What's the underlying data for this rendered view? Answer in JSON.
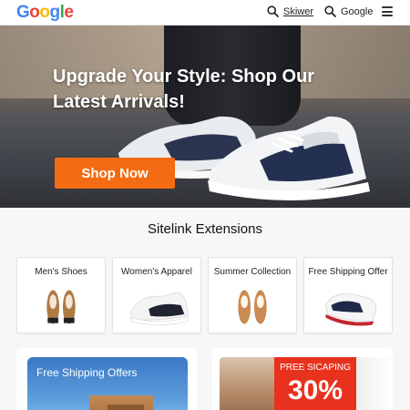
{
  "header": {
    "logo_letters": [
      "G",
      "o",
      "o",
      "g",
      "l",
      "e"
    ],
    "link1": "Skiwer",
    "link2": "Google"
  },
  "hero": {
    "title": "Upgrade Your Style: Shop Our Latest Arrivals!",
    "cta_label": "Shop Now"
  },
  "section": {
    "title": "Sitelink Extensions"
  },
  "sitelinks": [
    {
      "label": "Men's Shoes"
    },
    {
      "label": "Women's Apparel"
    },
    {
      "label": "Summer Collection"
    },
    {
      "label": "Free Shipping Offer"
    }
  ],
  "promos": {
    "left_title": "Free Shipping Offers",
    "right_badge_top": "PREE SICAPING",
    "right_badge_value": "30%"
  },
  "colors": {
    "cta": "#f36b12",
    "promo_badge": "#e8321e",
    "promo_blue": "#3a78c4"
  },
  "icons": [
    "search-icon",
    "search-icon",
    "menu-icon",
    "shoe-icon"
  ]
}
